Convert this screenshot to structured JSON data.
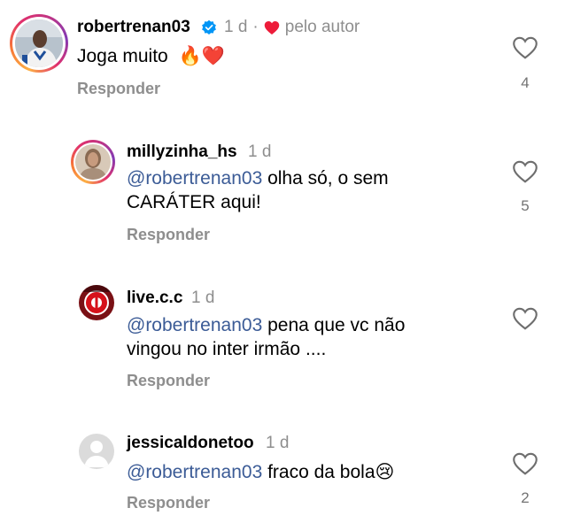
{
  "comments": [
    {
      "username": "robertrenan03",
      "verified": true,
      "time": "1 d",
      "separator": "·",
      "author_badge": "pelo autor",
      "text": "Joga muito",
      "emoji": "🔥❤️",
      "reply_label": "Responder",
      "likes": "4",
      "avatar": "player-photo"
    },
    {
      "username": "millyzinha_hs",
      "time": "1 d",
      "mention": "@robertrenan03",
      "text_line1": " olha só, o sem",
      "text_line2": "CARÁTER aqui!",
      "reply_label": "Responder",
      "likes": "5",
      "avatar": "person-photo"
    },
    {
      "username": "live.c.c",
      "time": "1 d",
      "mention": "@robertrenan03",
      "text_line1": " pena que vc não",
      "text_line2": "vingou no inter irmão ....",
      "reply_label": "Responder",
      "likes": "",
      "avatar": "club-logo"
    },
    {
      "username": "jessicaldonetoo",
      "time": "1 d",
      "mention": "@robertrenan03",
      "text": " fraco da bola",
      "emoji": "😢",
      "reply_label": "Responder",
      "likes": "2",
      "avatar": "default-avatar"
    }
  ],
  "colors": {
    "mention": "#3b5b96",
    "muted": "#8e8e8e",
    "verified": "#0095f6",
    "author_heart": "#ed1c3a"
  }
}
